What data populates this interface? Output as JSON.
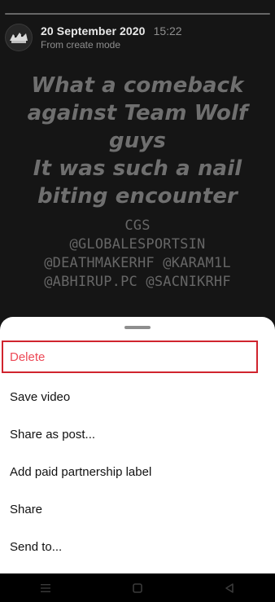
{
  "story": {
    "progress_fraction": 0.0,
    "date": "20 September 2020",
    "time": "15:22",
    "source": "From create mode",
    "text_lines": [
      "What a comeback",
      "against Team Wolf",
      "guys",
      "It was such a nail",
      "biting encounter"
    ],
    "mentions": [
      "CGS",
      "@GLOBALESPORTSIN",
      "@DEATHMAKERHF @KARAM1L",
      "@ABHIRUP.PC @SACNIKRHF"
    ]
  },
  "sheet": {
    "items": [
      {
        "label": "Delete",
        "color": "#ed4956"
      },
      {
        "label": "Save video"
      },
      {
        "label": "Share as post..."
      },
      {
        "label": "Add paid partnership label"
      },
      {
        "label": "Share"
      },
      {
        "label": "Send to..."
      }
    ]
  },
  "colors": {
    "background": "#151515",
    "sheet": "#ffffff",
    "destructive": "#ed4956",
    "highlight_border": "#d0242e"
  },
  "icons": {
    "nav": [
      "menu-icon",
      "home-square-icon",
      "back-triangle-icon"
    ]
  }
}
